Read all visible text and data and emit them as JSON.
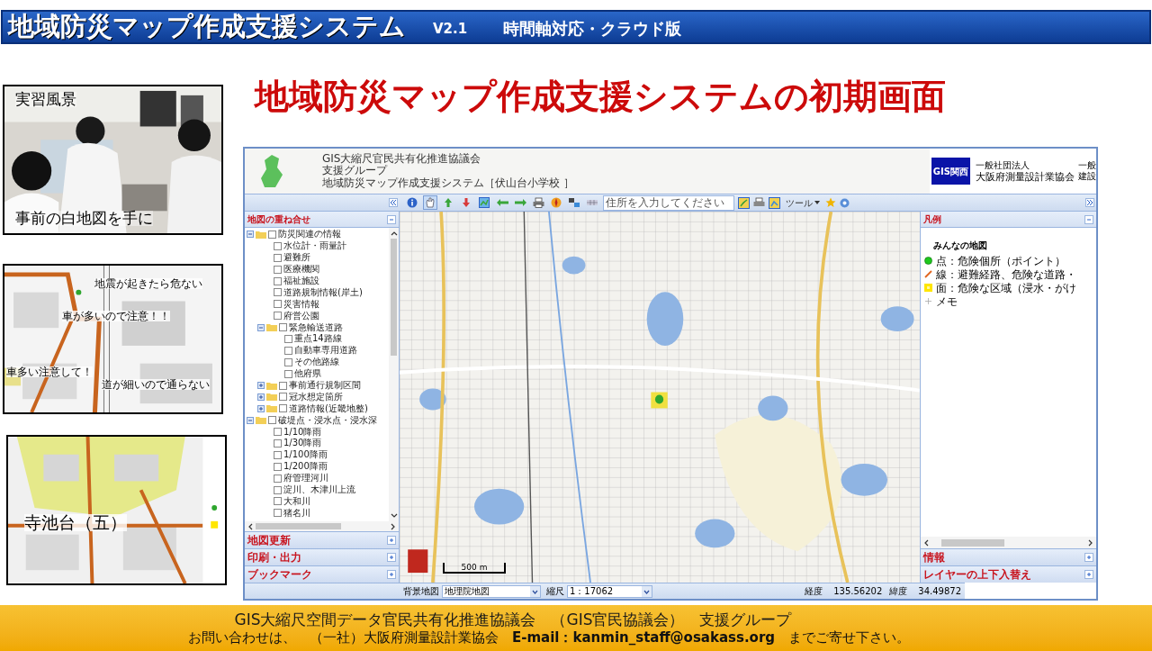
{
  "banner": {
    "title": "地域防災マップ作成支援システム",
    "version": "V2.1",
    "subtitle": "時間軸対応・クラウド版"
  },
  "heading": "地域防災マップ作成支援システムの初期画面",
  "thumbnails": [
    {
      "labels": [
        "実習風景",
        "事前の白地図を手に"
      ]
    },
    {
      "kind": "notes_map",
      "labels": [
        "地震が起きたら危ない",
        "車が多いので注意！！",
        "車多い注意して！",
        "道が細いので通らない"
      ]
    },
    {
      "kind": "area_map",
      "labels": [
        "寺池台（五）"
      ]
    }
  ],
  "app": {
    "header": {
      "org_lines": [
        "GIS大縮尺官民共有化推進協議会",
        "支援グループ"
      ],
      "system_title": "地域防災マップ作成支援システム［伏山台小学校 ］",
      "badge": "GIS関西",
      "partner_prefix": "一般社団法人",
      "partner_name": "大阪府測量設計業協会",
      "cut_lines": [
        "一般",
        "建設"
      ]
    },
    "toolbar": {
      "tools": [
        {
          "kind": "info",
          "selected": false
        },
        {
          "kind": "pan",
          "selected": true
        },
        {
          "kind": "zoom_in",
          "selected": false
        },
        {
          "kind": "zoom_out",
          "selected": false
        },
        {
          "kind": "extent",
          "selected": false
        },
        {
          "kind": "back",
          "selected": false
        },
        {
          "kind": "forward",
          "selected": false
        },
        {
          "kind": "print",
          "selected": false
        },
        {
          "kind": "move",
          "selected": false
        },
        {
          "kind": "measure",
          "selected": false
        },
        {
          "kind": "utm",
          "selected": false
        }
      ],
      "address_placeholder": "住所を入力してください",
      "tool_menu": "ツール"
    },
    "left_panel": {
      "title": "地図の重ね合せ",
      "tree": [
        {
          "kind": "folder",
          "label": "防災関連の情報",
          "expanded": true,
          "checked": false,
          "children": [
            {
              "kind": "layer",
              "label": "水位計・雨量計",
              "checked": false
            },
            {
              "kind": "layer",
              "label": "避難所",
              "checked": false
            },
            {
              "kind": "layer",
              "label": "医療機関",
              "checked": false
            },
            {
              "kind": "layer",
              "label": "福祉施設",
              "checked": false
            },
            {
              "kind": "layer",
              "label": "道路規制情報(岸土)",
              "checked": false
            },
            {
              "kind": "layer",
              "label": "災害情報",
              "checked": false
            },
            {
              "kind": "layer",
              "label": "府営公園",
              "checked": false
            },
            {
              "kind": "folder",
              "label": "緊急輸送道路",
              "expanded": true,
              "checked": false,
              "children": [
                {
                  "kind": "layer",
                  "label": "重点14路線",
                  "checked": false
                },
                {
                  "kind": "layer",
                  "label": "自動車専用道路",
                  "checked": false
                },
                {
                  "kind": "layer",
                  "label": "その他路線",
                  "checked": false
                },
                {
                  "kind": "layer",
                  "label": "他府県",
                  "checked": false
                }
              ]
            },
            {
              "kind": "folder",
              "label": "事前通行規制区間",
              "expanded": false,
              "checked": false
            },
            {
              "kind": "folder",
              "label": "冠水想定箇所",
              "expanded": false,
              "checked": false
            },
            {
              "kind": "folder",
              "label": "道路情報(近畿地整)",
              "expanded": false,
              "checked": false
            }
          ]
        },
        {
          "kind": "folder",
          "label": "破堤点・浸水点・浸水深",
          "expanded": true,
          "checked": false,
          "children": [
            {
              "kind": "layer",
              "label": "1/10降雨",
              "checked": false
            },
            {
              "kind": "layer",
              "label": "1/30降雨",
              "checked": false
            },
            {
              "kind": "layer",
              "label": "1/100降雨",
              "checked": false
            },
            {
              "kind": "layer",
              "label": "1/200降雨",
              "checked": false
            },
            {
              "kind": "layer",
              "label": "府管理河川",
              "checked": false
            },
            {
              "kind": "layer",
              "label": "淀川、木津川上流",
              "checked": false
            },
            {
              "kind": "layer",
              "label": "大和川",
              "checked": false
            },
            {
              "kind": "layer",
              "label": "猪名川",
              "checked": false
            }
          ]
        }
      ],
      "sections": [
        "地図更新",
        "印刷・出力",
        "ブックマーク"
      ]
    },
    "map": {
      "scale_label": "500 m"
    },
    "right_panel": {
      "title": "凡例",
      "legend_group": "みんなの地図",
      "legend": [
        {
          "kind": "point",
          "label": "点：危険個所（ポイント）"
        },
        {
          "kind": "line",
          "label": "線：避難経路、危険な道路・"
        },
        {
          "kind": "area",
          "label": "面：危険な区域（浸水・がけ"
        },
        {
          "kind": "memo",
          "label": "メモ"
        }
      ],
      "sections": [
        "情報",
        "レイヤーの上下入替え"
      ]
    },
    "status_bar": {
      "background_label": "背景地図",
      "background_value": "地理院地図",
      "scale_label": "縮尺",
      "scale_value": "1：17062",
      "lon_label": "経度",
      "lon_value": "135.56202",
      "lat_label": "緯度",
      "lat_value": "34.49872"
    }
  },
  "footer": {
    "line1": "GIS大縮尺空間データ官民共有化推進協議会　（GIS官民協議会）　支援グループ",
    "line2": "お問い合わせは、　（一社）大阪府測量設計業協会　**E-mail：kanmin_staff@osakass.org**　までご寄せ下さい。"
  }
}
